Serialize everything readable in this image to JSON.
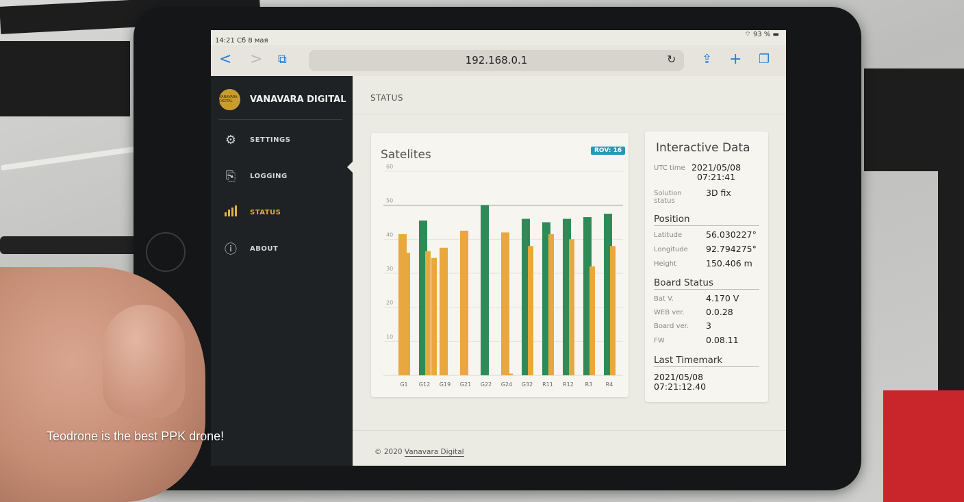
{
  "status_bar": {
    "time": "14:21  Сб 8 мая",
    "battery": "93 %"
  },
  "browser": {
    "url": "192.168.0.1",
    "back": "<",
    "forward": ">",
    "share": "⇪",
    "add": "+"
  },
  "sidebar": {
    "brand": "VANAVARA DIGITAL",
    "logo_text": "VANAVARA DIGITAL",
    "items": [
      {
        "label": "SETTINGS",
        "icon": "gear-icon"
      },
      {
        "label": "LOGGING",
        "icon": "documents-icon"
      },
      {
        "label": "STATUS",
        "icon": "bar-chart-icon"
      },
      {
        "label": "ABOUT",
        "icon": "info-icon"
      }
    ]
  },
  "header": {
    "title": "STATUS"
  },
  "chart_card": {
    "title": "Satelites",
    "badge": "ROV: 16"
  },
  "chart_data": {
    "type": "bar",
    "title": "Satelites",
    "categories": [
      "G1",
      "G12",
      "G19",
      "G21",
      "G22",
      "G24",
      "G32",
      "R11",
      "R12",
      "R3",
      "R4"
    ],
    "ylim": [
      0,
      60
    ],
    "yticks": [
      10,
      20,
      30,
      40,
      50,
      60
    ],
    "grid": true,
    "series": [
      {
        "color": "#2e8b57",
        "values": [
          null,
          45.5,
          null,
          null,
          50,
          null,
          46,
          45,
          46,
          46.5,
          47.5
        ]
      },
      {
        "color": "#e8a83e",
        "values": [
          41.5,
          36.5,
          37.5,
          42.5,
          null,
          42,
          38,
          41.5,
          40,
          32,
          38
        ]
      },
      {
        "color": "#e8a83e",
        "values": [
          36,
          34.5,
          null,
          null,
          null,
          0.5,
          null,
          null,
          null,
          null,
          null
        ]
      }
    ]
  },
  "info": {
    "title": "Interactive Data",
    "utc_label": "UTC time",
    "utc_value": "2021/05/08",
    "utc_value2": "07:21:41",
    "solution_label": "Solution",
    "solution_label2": "status",
    "solution_value": "3D fix",
    "position_head": "Position",
    "lat_label": "Latitude",
    "lat_value": "56.030227°",
    "lon_label": "Longitude",
    "lon_value": "92.794275°",
    "height_label": "Height",
    "height_value": "150.406 m",
    "board_head": "Board Status",
    "bat_label": "Bat V.",
    "bat_value": "4.170 V",
    "web_label": "WEB ver.",
    "web_value": "0.0.28",
    "board_label": "Board ver.",
    "board_value": "3",
    "fw_label": "FW",
    "fw_value": "0.08.11",
    "timemark_head": "Last Timemark",
    "timemark_value": "2021/05/08",
    "timemark_value2": "07:21:12.40"
  },
  "footer": {
    "prefix": "© 2020 ",
    "link": "Vanavara Digital"
  },
  "caption": "Teodrone is the best PPK drone!"
}
